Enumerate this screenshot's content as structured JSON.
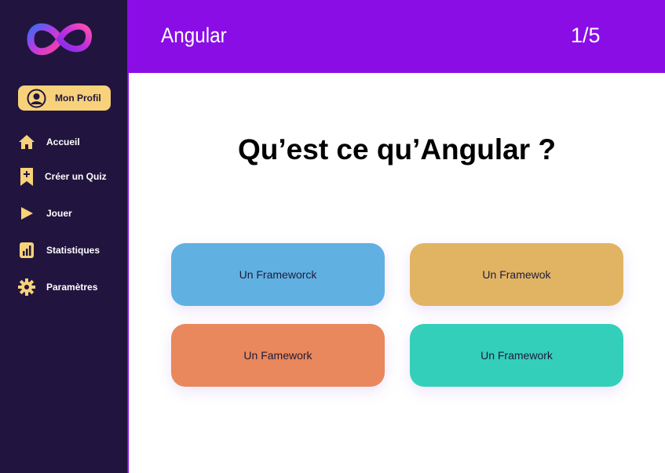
{
  "sidebar": {
    "logo_icon": "infinity-logo-icon",
    "profile_label": "Mon Profil",
    "items": [
      {
        "label": "Accueil",
        "icon": "home-icon"
      },
      {
        "label": "Créer un Quiz",
        "icon": "bookmark-plus-icon"
      },
      {
        "label": "Jouer",
        "icon": "play-icon"
      },
      {
        "label": "Statistiques",
        "icon": "bar-chart-icon"
      },
      {
        "label": "Paramètres",
        "icon": "gear-icon"
      }
    ]
  },
  "header": {
    "title": "Angular",
    "counter": "1/5"
  },
  "quiz": {
    "question": "Qu’est ce qu’Angular ?",
    "answers": [
      {
        "label": "Un Frameworck",
        "color": "#60b1e2"
      },
      {
        "label": "Un Framewok",
        "color": "#e1b464"
      },
      {
        "label": "Un Famework",
        "color": "#e8885c"
      },
      {
        "label": "Un Framework",
        "color": "#34cfba"
      }
    ]
  },
  "colors": {
    "sidebar_bg": "#21153f",
    "header_bg": "#8a0de6",
    "accent_yellow": "#f7d27a"
  }
}
